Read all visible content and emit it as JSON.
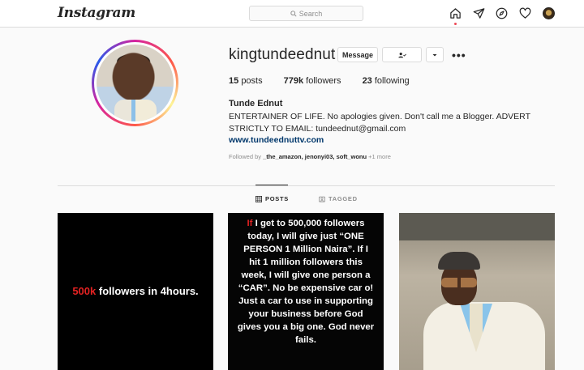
{
  "nav": {
    "logo": "Instagram",
    "search_placeholder": "Search",
    "icons": [
      "home-icon",
      "direct-icon",
      "explore-icon",
      "activity-icon",
      "profile-avatar"
    ]
  },
  "profile": {
    "username": "kingtundeednut",
    "message_label": "Message",
    "stats": {
      "posts_count": "15",
      "posts_label": "posts",
      "followers_count": "779k",
      "followers_label": "followers",
      "following_count": "23",
      "following_label": "following"
    },
    "full_name": "Tunde Ednut",
    "bio": "ENTERTAINER OF LIFE. No apologies given. Don't call me a Blogger. ADVERT STRICTLY TO EMAIL: tundeednut@gmail.com",
    "website": "www.tundeednuttv.com",
    "followed_by_prefix": "Followed by",
    "followed_by_names": "_the_amazon, jenonyi03, soft_wonu",
    "followed_by_more": "+1 more"
  },
  "tabs": {
    "posts": "POSTS",
    "tagged": "TAGGED"
  },
  "posts": {
    "post1_red": "500k",
    "post1_rest": " followers in 4hours.",
    "post2_red": "If",
    "post2_rest": " I get to 500,000 followers today, I will give just “ONE PERSON 1 Million Naira”. If I hit 1 million followers this week, I will give one person a “CAR”. No be expensive car o! Just a car to use in supporting your business before God gives you a big one. God never fails."
  },
  "colors": {
    "link": "#00376b",
    "accent_red": "#e32222",
    "notification_dot": "#ed4956"
  }
}
